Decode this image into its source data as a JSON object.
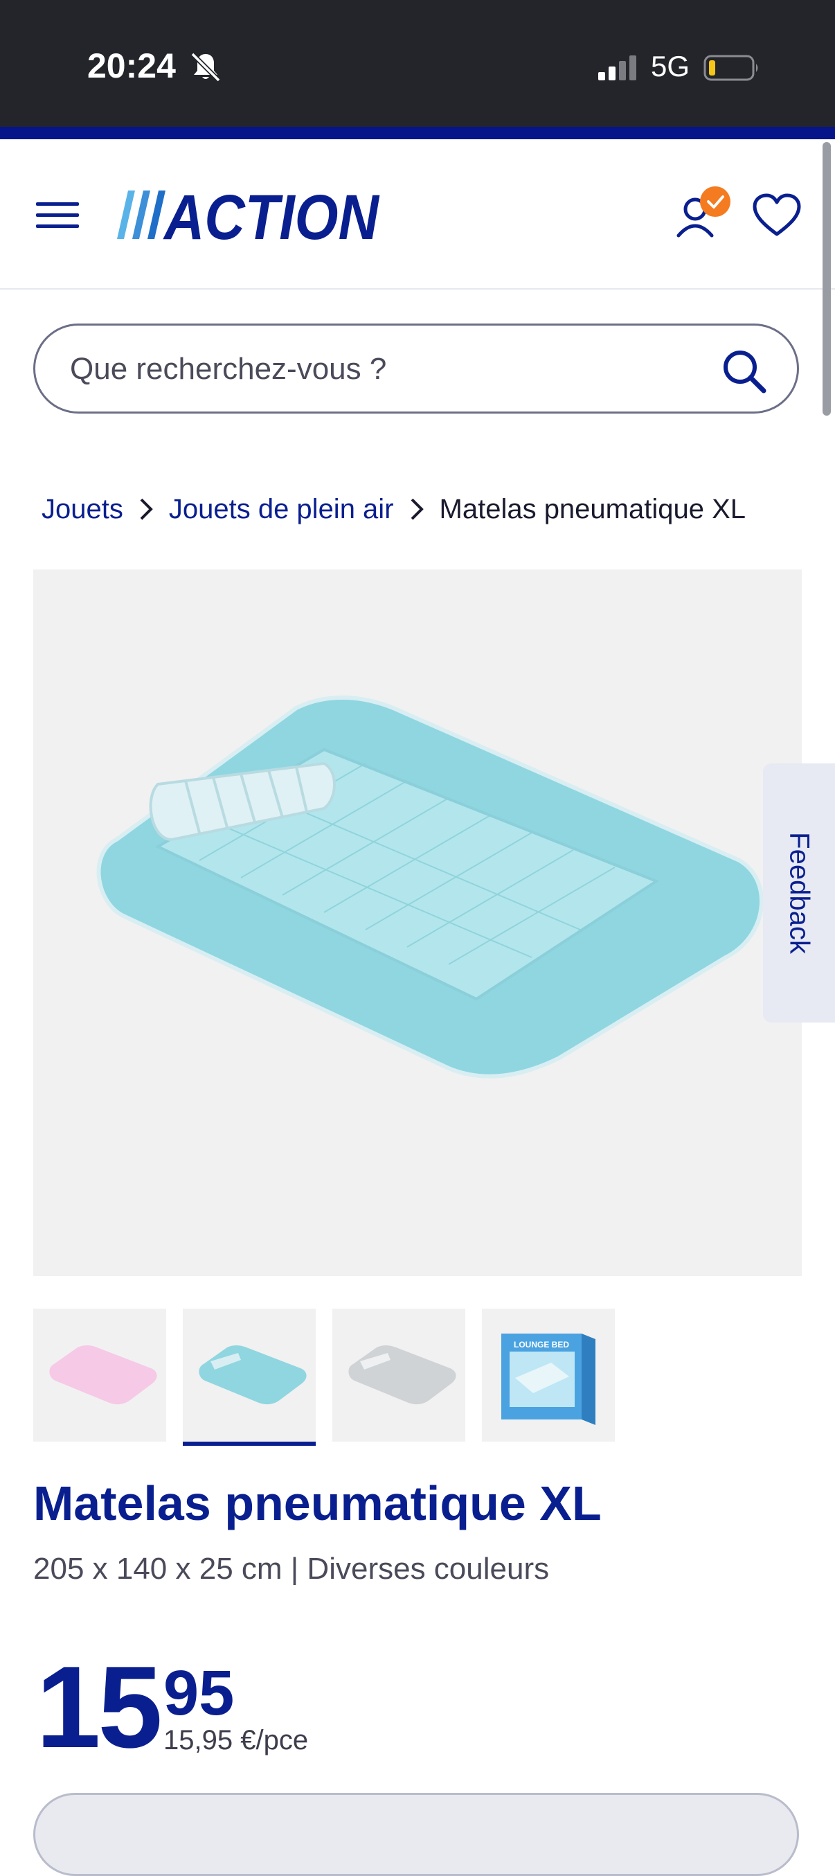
{
  "status_bar": {
    "time": "20:24",
    "network": "5G",
    "icons": [
      "bell-muted-icon",
      "signal-icon",
      "battery-low-icon"
    ]
  },
  "header": {
    "logo_text": "ACTION",
    "brand_color": "#0a1f8f",
    "icons": [
      "menu-icon",
      "user-icon",
      "heart-icon"
    ],
    "user_badge_color": "#f47b20"
  },
  "search": {
    "placeholder": "Que recherchez-vous ?"
  },
  "breadcrumb": {
    "items": [
      "Jouets",
      "Jouets de plein air"
    ],
    "current": "Matelas pneumatique XL"
  },
  "feedback": {
    "label": "Feedback"
  },
  "gallery": {
    "thumbnails": [
      "pink-mattress",
      "turquoise-mattress",
      "grey-mattress",
      "lounge-bed-box"
    ],
    "active_index": 1,
    "box_label": "LOUNGE BED"
  },
  "product": {
    "title": "Matelas pneumatique XL",
    "subtitle": "205 x 140 x 25 cm | Diverses couleurs",
    "price_int": "15",
    "price_dec": "95",
    "unit_price": "15,95 €/pce"
  }
}
